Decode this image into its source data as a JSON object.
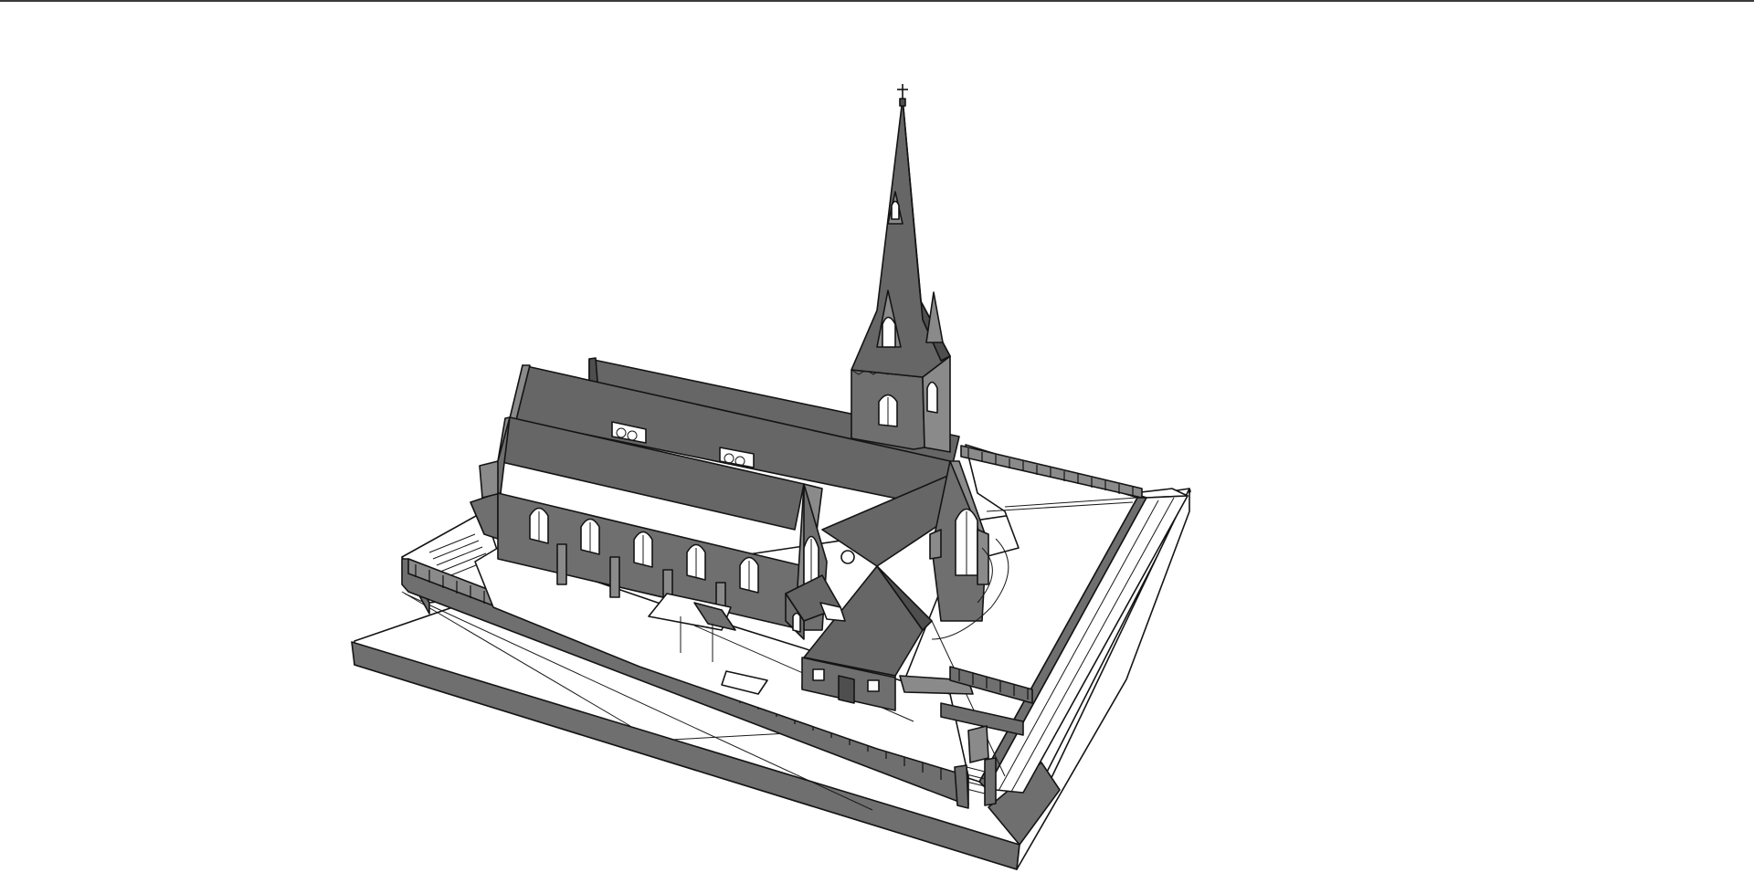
{
  "viewport": {
    "background": "#ffffff",
    "border_color": "#3a3a3a",
    "render_style": "hidden-line shaded 3D model"
  },
  "model": {
    "subject": "church-with-spire-on-site-block",
    "palette": {
      "roof": "#666666",
      "wall": "#6f6f6f",
      "ground": "#ffffff",
      "edges": "#141414"
    }
  }
}
